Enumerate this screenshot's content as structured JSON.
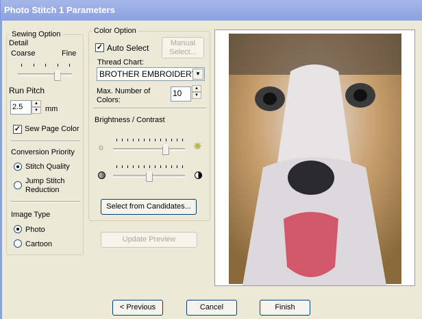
{
  "window": {
    "title": "Photo Stitch 1 Parameters"
  },
  "sewing": {
    "legend": "Sewing Option",
    "detail_label": "Detail",
    "coarse": "Coarse",
    "fine": "Fine",
    "detail_value": 3,
    "detail_max": 4,
    "run_pitch_label": "Run Pitch",
    "run_pitch_value": "2.5",
    "run_pitch_unit": "mm",
    "sew_page_color": "Sew Page Color",
    "sew_page_color_checked": true,
    "conversion_label": "Conversion Priority",
    "stitch_quality": "Stitch Quality",
    "jump_stitch": "Jump Stitch Reduction",
    "conversion_selected": "Stitch Quality",
    "image_type_label": "Image Type",
    "photo": "Photo",
    "cartoon": "Cartoon",
    "image_type_selected": "Photo"
  },
  "color": {
    "legend": "Color Option",
    "auto_select": "Auto Select",
    "auto_select_checked": true,
    "manual_select": "Manual Select...",
    "thread_chart_label": "Thread Chart:",
    "thread_chart_value": "BROTHER EMBROIDERY",
    "max_colors_label": "Max. Number of Colors:",
    "max_colors_value": "10",
    "bc_label": "Brightness / Contrast",
    "brightness_value": 9,
    "contrast_value": 6,
    "slider_max": 12,
    "candidates_button": "Select from Candidates..."
  },
  "update_preview": "Update Preview",
  "footer": {
    "previous": "< Previous",
    "cancel": "Cancel",
    "finish": "Finish"
  }
}
